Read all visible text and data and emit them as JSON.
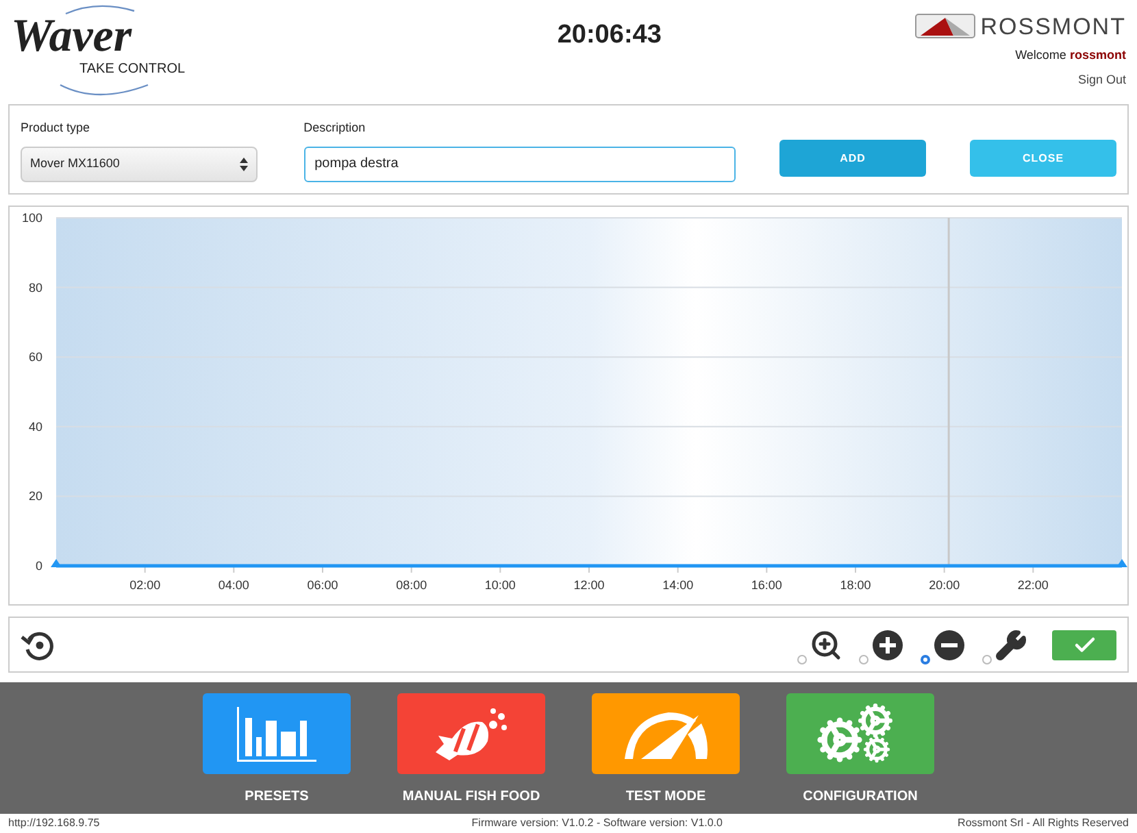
{
  "header": {
    "logo_text": "Waver",
    "logo_tagline": "TAKE CONTROL",
    "clock": "20:06:43",
    "brand": "ROSSMONT",
    "welcome": "Welcome",
    "username": "rossmont",
    "sign_out": "Sign Out"
  },
  "form": {
    "product_label": "Product type",
    "product_value": "Mover MX11600",
    "description_label": "Description",
    "description_value": "pompa destra",
    "buttons": [
      {
        "label": "ADD",
        "kind": "primary"
      },
      {
        "label": "CLOSE",
        "kind": "secondary"
      }
    ]
  },
  "chart": {
    "chart_data": {
      "type": "line",
      "x": [
        0,
        24
      ],
      "series": [
        {
          "color": "#2196f3",
          "values": [
            0,
            0
          ],
          "marker": "triangle"
        }
      ],
      "grid": true,
      "xlim": [
        0,
        24
      ],
      "ylim": [
        0,
        100
      ],
      "xticks": [
        {
          "value": 2,
          "label": "02:00"
        },
        {
          "value": 4,
          "label": "04:00"
        },
        {
          "value": 6,
          "label": "06:00"
        },
        {
          "value": 8,
          "label": "08:00"
        },
        {
          "value": 10,
          "label": "10:00"
        },
        {
          "value": 12,
          "label": "12:00"
        },
        {
          "value": 14,
          "label": "14:00"
        },
        {
          "value": 16,
          "label": "16:00"
        },
        {
          "value": 18,
          "label": "18:00"
        },
        {
          "value": 20,
          "label": "20:00"
        },
        {
          "value": 22,
          "label": "22:00"
        }
      ],
      "yticks": [
        0,
        20,
        40,
        60,
        80,
        100
      ],
      "ref_lines": [
        {
          "axis": "x",
          "value": 20.1,
          "color": "#c8c8c8"
        }
      ]
    }
  },
  "toolbar": {
    "tools": [
      {
        "kind": "zoom",
        "selected": false
      },
      {
        "kind": "add",
        "selected": false
      },
      {
        "kind": "remove",
        "selected": true
      },
      {
        "kind": "wrench",
        "selected": false
      }
    ]
  },
  "tiles": [
    {
      "label": "PRESETS",
      "kind": "presets",
      "color": "#2196f3"
    },
    {
      "label": "MANUAL FISH FOOD",
      "kind": "fish",
      "color": "#f44336"
    },
    {
      "label": "TEST MODE",
      "kind": "gauge",
      "color": "#ff9800"
    },
    {
      "label": "CONFIGURATION",
      "kind": "gears",
      "color": "#4caf50"
    }
  ],
  "footer": {
    "address": "http://192.168.9.75",
    "versions": "Firmware version: V1.0.2 - Software version: V1.0.0",
    "copyright": "Rossmont Srl - All Rights Reserved"
  }
}
